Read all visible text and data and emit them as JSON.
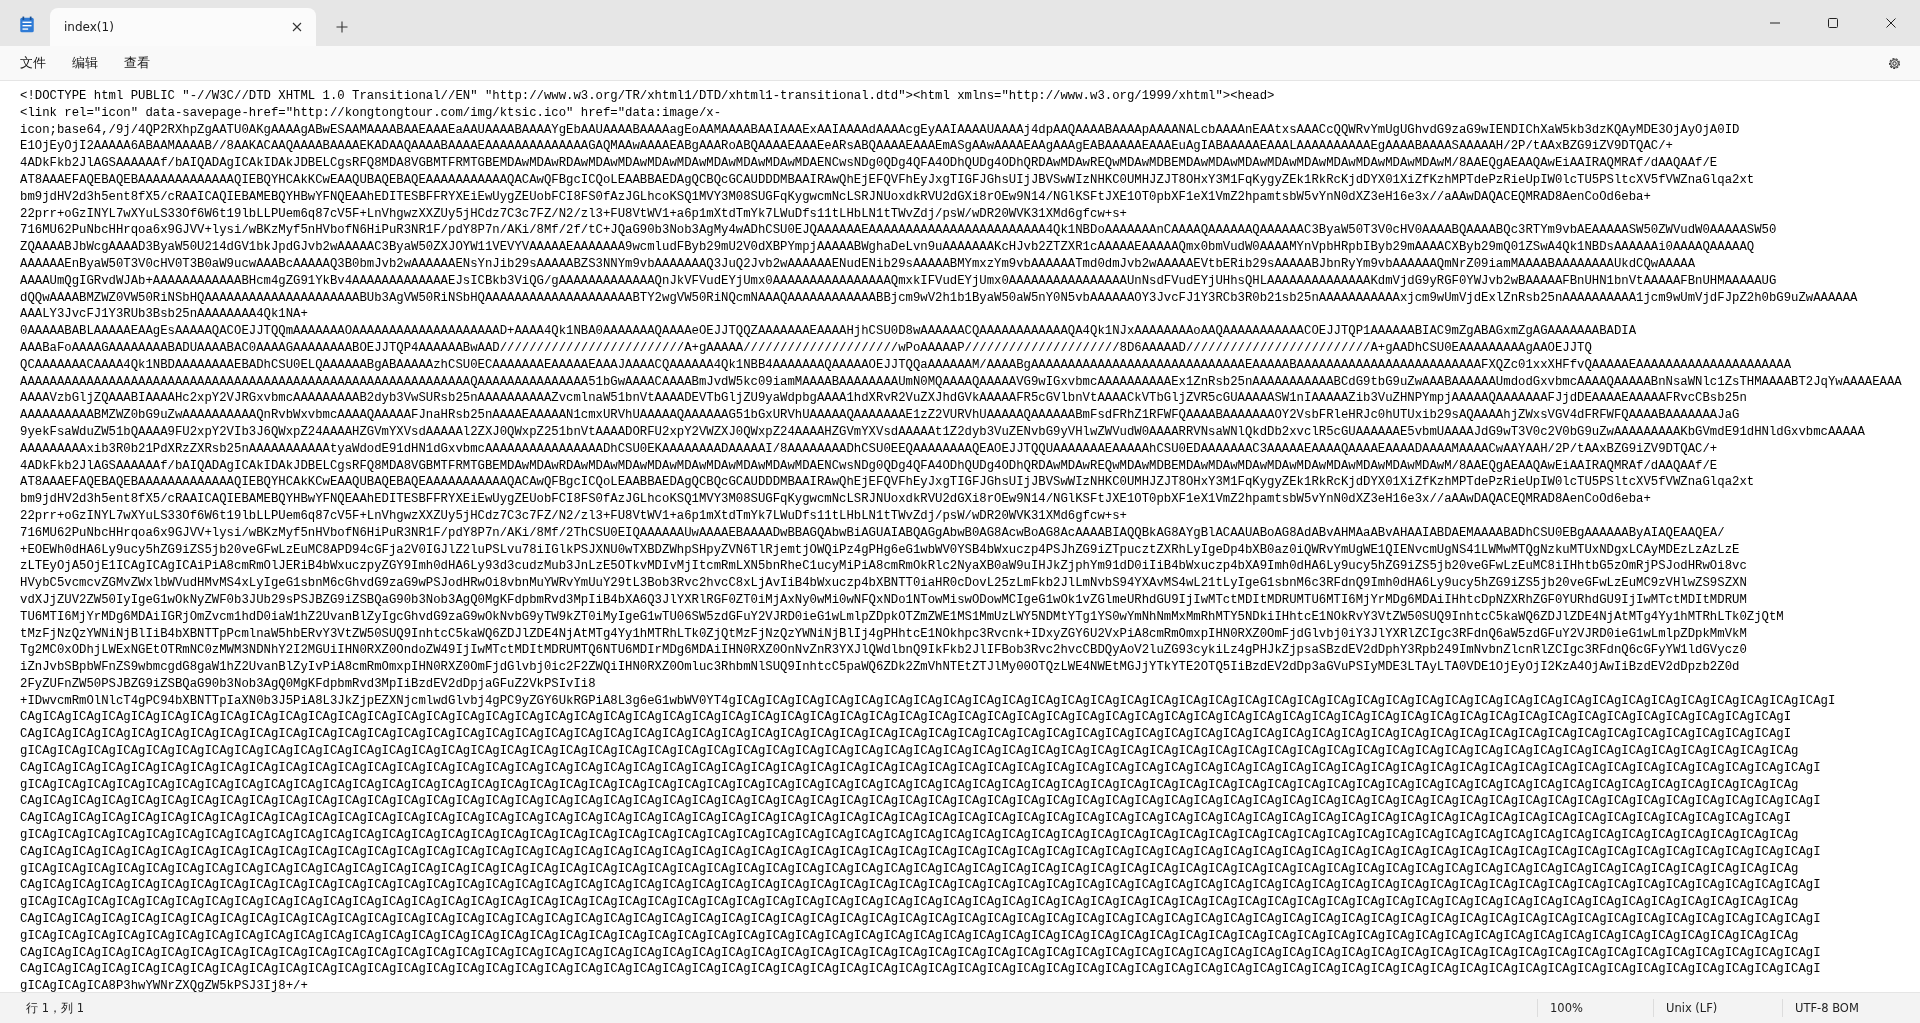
{
  "tab": {
    "title": "index(1)",
    "selected": true
  },
  "menu": [
    {
      "label": "文件"
    },
    {
      "label": "编辑"
    },
    {
      "label": "查看"
    }
  ],
  "editor": {
    "lines": [
      "<!DOCTYPE html PUBLIC \"-//W3C//DTD XHTML 1.0 Transitional//EN\" \"http://www.w3.org/TR/xhtml1/DTD/xhtml1-transitional.dtd\"><html xmlns=\"http://www.w3.org/1999/xhtml\"><head>",
      "<link rel=\"icon\" data-savepage-href=\"http://kongtongtour.com/img/ktsic.ico\" href=\"data:image/x-",
      "icon;base64,/9j/4QP2RXhpZgAATU0AKgAAAAgABwESAAMAAAABAAEAAAEaAAUAAAABAAAAYgEbAAUAAAABAAAAagEoAAMAAAABAAIAAAExAAIAAAAdAAAAcgEyAAIAAAAUAAAAj4dpAAQAAAABAAAApAAAANALcbAAAAnEAAtxsAAACcQQWRvYmUgUGhvdG9zaG9wIENDIChXaW5kb3dzKQAyMDE3OjAyOjA0ID",
      "E1OjEyOjI2AAAAA6ABAAMAAAAB//8AAKACAAQAAAABAAAAEKADAAQAAAABAAAAEAAAAAAAAAAAAAAGAQMAAwAAAAEABgAAARoABQAAAAEAAAEeARsABQAAAAEAAAEmASgAAwAAAAEAAgAAAgEABAAAAAEAAAEuAgIABAAAAAEAAALAAAAAAAAAAEgAAAABAAAASAAAAAH/2P/tAAxBZG9iZV9DTQAC/+",
      "4ADkFkb2JlAGSAAAAAAf/bAIQADAgICAkIDAkJDBELCgsRFQ8MDA8VGBMTFRMTGBEMDAwMDAwRDAwMDAwMDAwMDAwMDAwMDAwMDAwMDAwMDAENCwsNDg0QDg4QFA4ODhQUDg4ODhQRDAwMDAwREQwMDAwMDBEMDAwMDAwMDAwMDAwMDAwMDAwMDAwMDAwMDAwM/8AAEQgAEAAQAwEiAAIRAQMRAf/dAAQAAf/E",
      "AT8AAAEFAQEBAQEBAAAAAAAAAAAAAQIEBQYHCAkKCwEAAQUBAQEBAQEAAAAAAAAAAAQACAwQFBgcICQoLEAABBAEDAgQCBQcGCAUDDDMBAAIRAwQhEjEFQVFhEyJxgTIGFJGhsUIjJBVSwWIzNHKC0UMHJZJT8OHxY3M1FqKygyZEk1RkRcKjdDYX01XiZfKzhMPTdePzRieUpIW0lcTU5PSltcXV5fVWZnaGlqa2xt",
      "bm9jdHV2d3h5ent8fX5/cRAAICAQIEBAMEBQYHBwYFNQEAAhEDITESBFFRYXEiEwUygZEUobFCI8FS0fAzJGLhcoKSQ1MVY3M08SUGFqKygwcmNcLSRJNUoxdkRVU2dGXi8rOEw9N14/NGlKSFtJXE1OT0pbXF1eX1VmZ2hpamtsbW5vYnN0dXZ3eH16e3x//aAAwDAQACEQMRAD8AenCoOd6eba+",
      "22prr+oGzINYL7wXYuLS33Of6W6t19lbLLPUem6q87cV5F+LnVhgwzXXZUy5jHCdz7C3c7FZ/N2/zl3+FU8VtWV1+a6p1mXtdTmYk7LWuDfs11tLHbLN1tTWvZdj/psW/wDR20WVK31XMd6gfcw+s+",
      "716MU62PuNbcHHrqoa6x9GJVV+lysi/wBKzMyf5nHVbofN6HiPuR3NR1F/pdY8P7n/AKi/8Mf/2f/tC+JQaG90b3Nob3AgMy4wADhCSU0EJQAAAAAAEAAAAAAAAAAAAAAAAAAAAAAAA4Qk1NBDoAAAAAAAnCAAAAQAAAAAAQAAAAAAC3ByaW50T3V0cHV0AAAABQAAAABQc3RTYm9vbAEAAAAASW50ZWVudW0AAAAASW50",
      "ZQAAAABJbWcgAAAAD3ByaW50U214dGV1bkJpdGJvb2wAAAAAC3ByaW50ZXJOYW11VEVYVAAAAAEAAAAAAA9wcmludFByb29mU2V0dXBPYmpjAAAAABWghaDeLvn9uAAAAAAAKcHJvb2ZTZXR1cAAAAAEAAAAAQmx0bmVudW0AAAAMYnVpbHRpbIByb29mAAAACXByb29mQ01ZSwA4Qk1NBDsAAAAAAi0AAAAQAAAAAQ",
      "AAAAAAEnByaW50T3V0cHV0T3B0aW9ucwAAABcAAAAAQ3B0bmJvb2wAAAAAAENsYnJib29sAAAAABZS3NNYm9vbAAAAAAAQ3JuQ2Jvb2wAAAAAAENudENib29sAAAAABMYmxzYm9vbAAAAAATmd0dmJvb2wAAAAAEVtbERib29sAAAAABJbnRyYm9vbAAAAAAQmNrZ09iamMAAAABAAAAAAAAUkdCQwAAAAA",
      "AAAAUmQgIGRvdWJAb+AAAAAAAAAAAABHcm4gZG91YkBv4AAAAAAAAAAAAAEJsICBkb3ViQG/gAAAAAAAAAAAAAQnJkVFVudEYjUmx0AAAAAAAAAAAAAAAAQmxkIFVudEYjUmx0AAAAAAAAAAAAAAAAUnNsdFVudEYjUHhsQHLAAAAAAAAAAAAAAKdmVjdG9yRGF0YWJvb2wBAAAAAFBnUHN1bnVtAAAAAFBnUHMAAAAAUG",
      "dQQwAAAABMZWZ0VW50RiNSbHQAAAAAAAAAAAAAAAAAAAAABUb3AgVW50RiNSbHQAAAAAAAAAAAAAAAAAAAABTY2wgVW50RiNQcmNAAAQAAAAAAAAAAAABBjcm9wV2h1b1ByaW50aW5nY0N5vbAAAAAAOY3JvcFJ1Y3RCb3R0b21sb25nAAAAAAAAAAAxjcm9wUmVjdExlZnRsb25nAAAAAAAAAA1jcm9wUmVjdFJpZ2h0bG9uZwAAAAAA",
      "AAALY3JvcFJ1Y3RUb3Bsb25nAAAAAAAA4Qk1NA+",
      "0AAAAABABLAAAAAEAAgEsAAAAAQACOEJJTQQmAAAAAAAOAAAAAAAAAAAAAAAAAAAAD+AAAA4Qk1NBA0AAAAAAAQAAAAeOEJJTQQZAAAAAAAEAAAAHjhCSU0D8wAAAAAACQAAAAAAAAAAAAQA4Qk1NJxAAAAAAAAoAAQAAAAAAAAAAACOEJJTQP1AAAAAABIAC9mZgABAGxmZgAGAAAAAAABADIA",
      "AAABaFoAAAAGAAAAAAAABADUAAAABAC0AAAAGAAAAAAAABOEJJTQP4AAAAAABwAAD/////////////////////////A+gAAAAA/////////////////////wPoAAAAAP/////////////////////8D6AAAAAD/////////////////////////A+gAADhCSU0EAAAAAAAAAgAAOEJJTQ",
      "QCAAAAAAACAAAA4Qk1NBDAAAAAAAAEBADhCSU0ELQAAAAAABgABAAAAAzhCSU0ECAAAAAAAEAAAAAEAAAJAAAACQAAAAAA4Qk1NBB4AAAAAAAQAAAAAOEJJTQQaAAAAAAM/AAAABgAAAAAAAAAAAAAAAAAAAAAAAAAAAAAEAAAAABAAAAAAAAAAAAAAAAAAAAAAAAAFXQZc01xxXHFfvQAAAAAEAAAAAAAAAAAAAAAAAAAAA",
      "AAAAAAAAAAAAAAAAAAAAAAAAAAAAAAAAAAAAAAAAAAAAAAAAAAAAAAAAAAAAAQAAAAAAAAAAAAAAA51bGwAAAACAAAABmJvdW5kc09iamMAAAABAAAAAAAAUmN0MQAAAAQAAAAAVG9wIGxvbmcAAAAAAAAAAEx1ZnRsb25nAAAAAAAAAAABCdG9tbG9uZwAAABAAAAAAUmdodGxvbmcAAAAQAAAAABnNsaWNlc1ZsTHMAAAABT2JqYwAAAAEAAA",
      "AAAAVzbGljZQAAABIAAAAHc2xpY2VJRGxvbmcAAAAAAAAAB2dyb3VwSURsb25nAAAAAAAAAAZvcmlnaW51bnVtAAAADEVTbGljZU9yaWdpbgAAAA1hdXRvR2VuZXJhdGVkAAAAAFR5cGVlbnVtAAAACkVTbGljZVR5cGUAAAAASW1nIAAAAAZib3VuZHNPYmpjAAAAAQAAAAAAAFJjdDEAAAAEAAAAAFRvcCBsb25n",
      "AAAAAAAAAABMZWZ0bG9uZwAAAAAAAAAAQnRvbWxvbmcAAAAQAAAAAFJnaHRsb25nAAAAEAAAAAN1cmxURVhUAAAAAQAAAAAAG51bGxURVhUAAAAAQAAAAAAAE1zZ2VURVhUAAAAAQAAAAAABmFsdFRhZ1RFWFQAAAABAAAAAAAOY2VsbFRleHRJc0hUTUxib29sAQAAAAhjZWxsVGV4dFRFWFQAAAABAAAAAAAJaG",
      "9yekFsaWduZW51bQAAAA9FU2xpY2VIb3J6QWxpZ24AAAAHZGVmYXVsdAAAAAl2ZXJ0QWxpZ251bnVtAAAADORFU2xpY2VWZXJ0QWxpZ24AAAAHZGVmYXVsdAAAAAt1Z2dyb3VuZENvbG9yVHlwZWVudW0AAAARRVNsaWNlQkdDb2xvclR5cGUAAAAAAE5vbmUAAAAJdG9wT3V0c2V0bG9uZwAAAAAAAAAKbGVmdE91dHNldGxvbmcAAAAA",
      "AAAAAAAAAxib3R0b21PdXRzZXRsb25nAAAAAAAAAAAtyaWdodE91dHN1dGxvbmcAAAAAAAAAAAAAAAADhCSU0EKAAAAAAAADAAAAAI/8AAAAAAAADhCSU0EEQAAAAAAAAQEAOEJJTQQUAAAAAAAEAAAAAhCSU0EDAAAAAAAC3AAAAAEAAAAQAAAAEAAAADAAAAMAAAACwAAYAAH/2P/tAAxBZG9iZV9DTQAC/+",
      "4ADkFkb2JlAGSAAAAAAf/bAIQADAgICAkIDAkJDBELCgsRFQ8MDA8VGBMTFRMTGBEMDAwMDAwRDAwMDAwMDAwMDAwMDAwMDAwMDAwMDAwMDAENCwsNDg0QDg4QFA4ODhQUDg4ODhQRDAwMDAwREQwMDAwMDBEMDAwMDAwMDAwMDAwMDAwMDAwMDAwMDAwMDAwM/8AAEQgAEAAQAwEiAAIRAQMRAf/dAAQAAf/E",
      "AT8AAAEFAQEBAQEBAAAAAAAAAAAAAQIEBQYHCAkKCwEAAQUBAQEBAQEAAAAAAAAAAAQACAwQFBgcICQoLEAABBAEDAgQCBQcGCAUDDDMBAAIRAwQhEjEFQVFhEyJxgTIGFJGhsUIjJBVSwWIzNHKC0UMHJZJT8OHxY3M1FqKygyZEk1RkRcKjdDYX01XiZfKzhMPTdePzRieUpIW0lcTU5PSltcXV5fVWZnaGlqa2xt",
      "bm9jdHV2d3h5ent8fX5/cRAAICAQIEBAMEBQYHBwYFNQEAAhEDITESBFFRYXEiEwUygZEUobFCI8FS0fAzJGLhcoKSQ1MVY3M08SUGFqKygwcmNcLSRJNUoxdkRVU2dGXi8rOEw9N14/NGlKSFtJXE1OT0pbXF1eX1VmZ2hpamtsbW5vYnN0dXZ3eH16e3x//aAAwDAQACEQMRAD8AenCoOd6eba+",
      "22prr+oGzINYL7wXYuLS33Of6W6t19lbLLPUem6q87cV5F+LnVhgwzXXZUy5jHCdz7C3c7FZ/N2/zl3+FU8VtWV1+a6p1mXtdTmYk7LWuDfs11tLHbLN1tTWvZdj/psW/wDR20WVK31XMd6gfcw+s+",
      "716MU62PuNbcHHrqoa6x9GJVV+lysi/wBKzMyf5nHVbofN6HiPuR3NR1F/pdY8P7n/AKi/8Mf/2ThCSU0EIQAAAAAAUwAAAAEBAAAADwBBAGQAbwBiAGUAIABQAGgAbwB0AG8AcwBoAG8AcAAAABIAQQBkAG8AYgBlACAAUABoAG8AdABvAHMAaABvAHAAIABDAEMAAAABADhCSU0EBgAAAAAAByAIAQEAAQEA/",
      "+EOEWh0dHA6Ly9ucy5hZG9iZS5jb20veGFwLzEuMC8APD94cGFja2V0IGJlZ2luPSLvu78iIGlkPSJXNU0wTXBDZWhpSHpyZVN6TlRjemtjOWQiPz4gPHg6eG1wbWV0YSB4bWxuczp4PSJhZG9iZTpucztZXRhLyIgeDp4bXB0az0iQWRvYmUgWE1QIENvcmUgNS41LWMwMTQgNzkuMTUxNDgxLCAyMDEzLzAzLzE",
      "zLTEyOjA5OjE1ICAgICAgICAiPiA8cmRmOlJERiB4bWxuczpyZGY9Imh0dHA6Ly93d3cudzMub3JnLzE5OTkvMDIvMjItcmRmLXN5bnRheC1ucyMiPiA8cmRmOkRlc2NyaXB0aW9uIHJkZjphYm91dD0iIiB4bWxuczp4bXA9Imh0dHA6Ly9ucy5hZG9iZS5jb20veGFwLzEuMC8iIHhtbG5zOmRjPSJodHRwOi8vc",
      "HVybC5vcmcvZGMvZWxlbWVudHMvMS4xLyIgeG1sbnM6cGhvdG9zaG9wPSJodHRwOi8vbnMuYWRvYmUuY29tL3Bob3Rvc2hvcC8xLjAvIiB4bWxuczp4bXBNTT0iaHR0cDovL25zLmFkb2JlLmNvbS94YXAvMS4wL21tLyIgeG1sbnM6c3RFdnQ9Imh0dHA6Ly9ucy5hZG9iZS5jb20veGFwLzEuMC9zVHlwZS9SZXN",
      "vdXJjZUV2ZW50IyIgeG1wOkNyZWF0b3JUb29sPSJBZG9iZSBQaG90b3Nob3AgQ0MgKFdpbmRvd3MpIiB4bXA6Q3JlYXRlRGF0ZT0iMjAxNy0wMi0wNFQxNDo1NTowMiswODowMCIgeG1wOk1vZGlmeURhdGU9IjIwMTctMDItMDRUMTU6MTI6MjYrMDg6MDAiIHhtcDpNZXRhZGF0YURhdGU9IjIwMTctMDItMDRUM",
      "TU6MTI6MjYrMDg6MDAiIGRjOmZvcm1hdD0iaW1hZ2UvanBlZyIgcGhvdG9zaG9wOkNvbG9yTW9kZT0iMyIgeG1wTU06SW5zdGFuY2VJRD0ieG1wLmlpZDpkOTZmZWE1MS1MmUzLWY5NDMtYTg1YS0wYmNhNmMxMmRhMTY5NDkiIHhtcE1NOkRvY3VtZW50SUQ9InhtcC5kaWQ6ZDJlZDE4NjAtMTg4Yy1hMTRhLTk0ZjQtM",
      "tMzFjNzQzYWNiNjBlIiB4bXBNTTpPcmlnaW5hbERvY3VtZW50SUQ9InhtcC5kaWQ6ZDJlZDE4NjAtMTg4Yy1hMTRhLTk0ZjQtMzFjNzQzYWNiNjBlIj4gPHhtcE1NOkhpc3Rvcnk+IDxyZGY6U2VxPiA8cmRmOmxpIHN0RXZ0OmFjdGlvbj0iY3JlYXRlZCIgc3RFdnQ6aW5zdGFuY2VJRD0ieG1wLmlpZDpkMmVkM",
      "Tg2MC0xODhjLWExNGEtOTRmNC0zMWM3NDNhY2I2MGUiIHN0RXZ0OndoZW49IjIwMTctMDItMDRUMTQ6NTU6MDIrMDg6MDAiIHN0RXZ0OnNvZnR3YXJlQWdlbnQ9IkFkb2JlIFBob3Rvc2hvcCBDQyAoV2luZG93cykiLz4gPHJkZjpsaSBzdEV2dDphY3Rpb249ImNvbnZlcnRlZCIgc3RFdnQ6cGFyYW1ldGVycz0",
      "iZnJvbSBpbWFnZS9wbmcgdG8gaW1hZ2UvanBlZyIvPiA8cmRmOmxpIHN0RXZ0OmFjdGlvbj0ic2F2ZWQiIHN0RXZ0Omluc3RhbmNlSUQ9InhtcC5paWQ6ZDk2ZmVhNTEtZTJlMy00OTQzLWE4NWEtMGJjYTkYTE2OTQ5IiBzdEV2dDp3aGVuPSIyMDE3LTAyLTA0VDE1OjEyOjI2KzA4OjAwIiBzdEV2dDpzb2Z0d",
      "2FyZUFnZW50PSJBZG9iZSBQaG90b3Nob3AgQ0MgKFdpbmRvd3MpIiBzdEV2dDpjaGFuZ2VkPSIvIi8",
      "+IDwvcmRmOlNlcT4gPC94bXBNTTpIaXN0b3J5PiA8L3JkZjpEZXNjcmlwdGlvbj4gPC9yZGY6UkRGPiA8L3g6eG1wbWV0YT4gICAgICAgICAgICAgICAgICAgICAgICAgICAgICAgICAgICAgICAgICAgICAgICAgICAgICAgICAgICAgICAgICAgICAgICAgICAgICAgICAgICAgICAgICAgICAgICAgICAgICAgICAgICAgICAgI",
      "CAgICAgICAgICAgICAgICAgICAgICAgICAgICAgICAgICAgICAgICAgICAgICAgICAgICAgICAgICAgICAgICAgICAgICAgICAgICAgICAgICAgICAgICAgICAgICAgICAgICAgICAgICAgICAgICAgICAgICAgICAgICAgICAgICAgICAgICAgICAgICAgICAgICAgICAgICAgICAgICAgICAgICAgICAgICAgICAgICAgI",
      "CAgICAgICAgICAgICAgICAgICAgICAgICAgICAgICAgICAgICAgICAgICAgICAgICAgICAgICAgICAgICAgICAgICAgICAgICAgICAgICAgICAgICAgICAgICAgICAgICAgICAgICAgICAgICAgICAgICAgICAgICAgICAgICAgICAgICAgICAgICAgICAgICAgICAgICAgICAgICAgICAgICAgICAgICAgICAgICAgICAgI",
      "gICAgICAgICAgICAgICAgICAgICAgICAgICAgICAgICAgICAgICAgICAgICAgICAgICAgICAgICAgICAgICAgICAgICAgICAgICAgICAgICAgICAgICAgICAgICAgICAgICAgICAgICAgICAgICAgICAgICAgICAgICAgICAgICAgICAgICAgICAgICAgICAgICAgICAgICAgICAgICAgICAgICAgICAgICAgICAgICAgICAg",
      "CAgICAgICAgICAgICAgICAgICAgICAgICAgICAgICAgICAgICAgICAgICAgICAgICAgICAgICAgICAgICAgICAgICAgICAgICAgICAgICAgICAgICAgICAgICAgICAgICAgICAgICAgICAgICAgICAgICAgICAgICAgICAgICAgICAgICAgICAgICAgICAgICAgICAgICAgICAgICAgICAgICAgICAgICAgICAgICAgICAgICAgI",
      "gICAgICAgICAgICAgICAgICAgICAgICAgICAgICAgICAgICAgICAgICAgICAgICAgICAgICAgICAgICAgICAgICAgICAgICAgICAgICAgICAgICAgICAgICAgICAgICAgICAgICAgICAgICAgICAgICAgICAgICAgICAgICAgICAgICAgICAgICAgICAgICAgICAgICAgICAgICAgICAgICAgICAgICAgICAgICAgICAgICAg",
      "CAgICAgICAgICAgICAgICAgICAgICAgICAgICAgICAgICAgICAgICAgICAgICAgICAgICAgICAgICAgICAgICAgICAgICAgICAgICAgICAgICAgICAgICAgICAgICAgICAgICAgICAgICAgICAgICAgICAgICAgICAgICAgICAgICAgICAgICAgICAgICAgICAgICAgICAgICAgICAgICAgICAgICAgICAgICAgICAgICAgICAgI",
      "CAgICAgICAgICAgICAgICAgICAgICAgICAgICAgICAgICAgICAgICAgICAgICAgICAgICAgICAgICAgICAgICAgICAgICAgICAgICAgICAgICAgICAgICAgICAgICAgICAgICAgICAgICAgICAgICAgICAgICAgICAgICAgICAgICAgICAgICAgICAgICAgICAgICAgICAgICAgICAgICAgICAgICAgICAgICAgICAgICAgI",
      "gICAgICAgICAgICAgICAgICAgICAgICAgICAgICAgICAgICAgICAgICAgICAgICAgICAgICAgICAgICAgICAgICAgICAgICAgICAgICAgICAgICAgICAgICAgICAgICAgICAgICAgICAgICAgICAgICAgICAgICAgICAgICAgICAgICAgICAgICAgICAgICAgICAgICAgICAgICAgICAgICAgICAgICAgICAgICAgICAgICAg",
      "CAgICAgICAgICAgICAgICAgICAgICAgICAgICAgICAgICAgICAgICAgICAgICAgICAgICAgICAgICAgICAgICAgICAgICAgICAgICAgICAgICAgICAgICAgICAgICAgICAgICAgICAgICAgICAgICAgICAgICAgICAgICAgICAgICAgICAgICAgICAgICAgICAgICAgICAgICAgICAgICAgICAgICAgICAgICAgICAgICAgICAgI",
      "gICAgICAgICAgICAgICAgICAgICAgICAgICAgICAgICAgICAgICAgICAgICAgICAgICAgICAgICAgICAgICAgICAgICAgICAgICAgICAgICAgICAgICAgICAgICAgICAgICAgICAgICAgICAgICAgICAgICAgICAgICAgICAgICAgICAgICAgICAgICAgICAgICAgICAgICAgICAgICAgICAgICAgICAgICAgICAgICAgICAg",
      "CAgICAgICAgICAgICAgICAgICAgICAgICAgICAgICAgICAgICAgICAgICAgICAgICAgICAgICAgICAgICAgICAgICAgICAgICAgICAgICAgICAgICAgICAgICAgICAgICAgICAgICAgICAgICAgICAgICAgICAgICAgICAgICAgICAgICAgICAgICAgICAgICAgICAgICAgICAgICAgICAgICAgICAgICAgICAgICAgICAgICAgI",
      "gICAgICAgICAgICAgICAgICAgICAgICAgICAgICAgICAgICAgICAgICAgICAgICAgICAgICAgICAgICAgICAgICAgICAgICAgICAgICAgICAgICAgICAgICAgICAgICAgICAgICAgICAgICAgICAgICAgICAgICAgICAgICAgICAgICAgICAgICAgICAgICAgICAgICAgICAgICAgICAgICAgICAgICAgICAgICAgICAgICAg",
      "CAgICAgICAgICAgICAgICAgICAgICAgICAgICAgICAgICAgICAgICAgICAgICAgICAgICAgICAgICAgICAgICAgICAgICAgICAgICAgICAgICAgICAgICAgICAgICAgICAgICAgICAgICAgICAgICAgICAgICAgICAgICAgICAgICAgICAgICAgICAgICAgICAgICAgICAgICAgICAgICAgICAgICAgICAgICAgICAgICAgICAgI",
      "gICAgICAgICAgICAgICAgICAgICAgICAgICAgICAgICAgICAgICAgICAgICAgICAgICAgICAgICAgICAgICAgICAgICAgICAgICAgICAgICAgICAgICAgICAgICAgICAgICAgICAgICAgICAgICAgICAgICAgICAgICAgICAgICAgICAgICAgICAgICAgICAgICAgICAgICAgICAgICAgICAgICAgICAgICAgICAgICAgICAg",
      "CAgICAgICAgICAgICAgICAgICAgICAgICAgICAgICAgICAgICAgICAgICAgICAgICAgICAgICAgICAgICAgICAgICAgICAgICAgICAgICAgICAgICAgICAgICAgICAgICAgICAgICAgICAgICAgICAgICAgICAgICAgICAgICAgICAgICAgICAgICAgICAgICAgICAgICAgICAgICAgICAgICAgICAgICAgICAgICAgICAgICAgI",
      "CAgICAgICAgICAgICAgICAgICAgICAgICAgICAgICAgICAgICAgICAgICAgICAgICAgICAgICAgICAgICAgICAgICAgICAgICAgICAgICAgICAgICAgICAgICAgICAgICAgICAgICAgICAgICAgICAgICAgICAgICAgICAgICAgICAgICAgICAgICAgICAgICAgICAgICAgICAgICAgICAgICAgICAgICAgICAgICAgICAgICAgI",
      "gICAgICAgICA8P3hwYWNrZXQgZW5kPSJ3Ij8+/+"
    ]
  },
  "status_bar": [
    "行 1，列 1",
    "100%",
    "Unix (LF)",
    "UTF-8 BOM"
  ]
}
